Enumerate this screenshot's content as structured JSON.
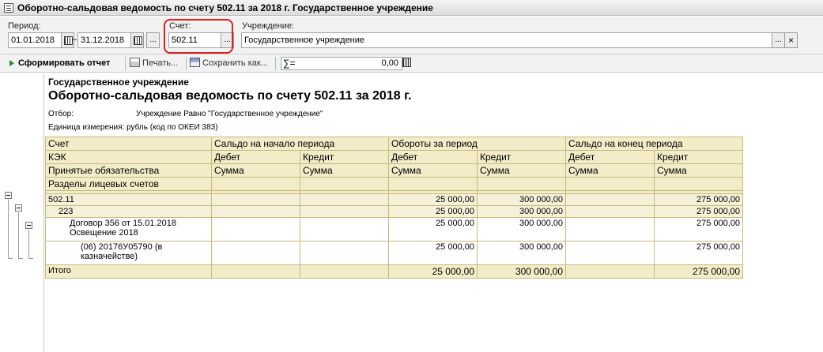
{
  "window": {
    "title": "Оборотно-сальдовая ведомость по счету 502.11 за 2018 г. Государственное учреждение"
  },
  "filters": {
    "period_label": "Период:",
    "period_from": "01.01.2018",
    "period_dash": "–",
    "period_to": "31.12.2018",
    "account_label": "Счет:",
    "account_value": "502.11",
    "institution_label": "Учреждение:",
    "institution_value": "Государственное учреждение",
    "select_btn": "...",
    "clear_btn": "×"
  },
  "toolbar": {
    "generate": "Сформировать отчет",
    "print": "Печать...",
    "save": "Сохранить как...",
    "sum_sign": "∑=",
    "sum_value": "0,00"
  },
  "report": {
    "organization": "Государственное учреждение",
    "title": "Оборотно-сальдовая ведомость по счету 502.11 за 2018 г.",
    "filter_label": "Отбор:",
    "filter_value": "Учреждение Равно \"Государственное учреждение\"",
    "unit": "Единица измерения: рубль (код по ОКЕИ 383)",
    "headers": {
      "account": "Счет",
      "kek": "КЭК",
      "obligations": "Принятые обязательства",
      "sections": "Разделы лицевых счетов",
      "opening": "Сальдо на начало периода",
      "turnover": "Обороты за период",
      "closing": "Сальдо на конец периода",
      "debit": "Дебет",
      "credit": "Кредит",
      "amount": "Сумма"
    },
    "rows": [
      {
        "label": "502.11",
        "od": "",
        "oc": "",
        "td": "25 000,00",
        "tc": "300 000,00",
        "cd": "",
        "cc": "275 000,00"
      },
      {
        "label": "223",
        "od": "",
        "oc": "",
        "td": "25 000,00",
        "tc": "300 000,00",
        "cd": "",
        "cc": "275 000,00"
      },
      {
        "label": "Договор 356 от 15.01.2018 Освещение 2018",
        "od": "",
        "oc": "",
        "td": "25 000,00",
        "tc": "300 000,00",
        "cd": "",
        "cc": "275 000,00"
      },
      {
        "label": "(06) 20176У05790 (в казначействе)",
        "od": "",
        "oc": "",
        "td": "25 000,00",
        "tc": "300 000,00",
        "cd": "",
        "cc": "275 000,00"
      }
    ],
    "total": {
      "label": "Итого",
      "od": "",
      "oc": "",
      "td": "25 000,00",
      "tc": "300 000,00",
      "cd": "",
      "cc": "275 000,00"
    }
  }
}
